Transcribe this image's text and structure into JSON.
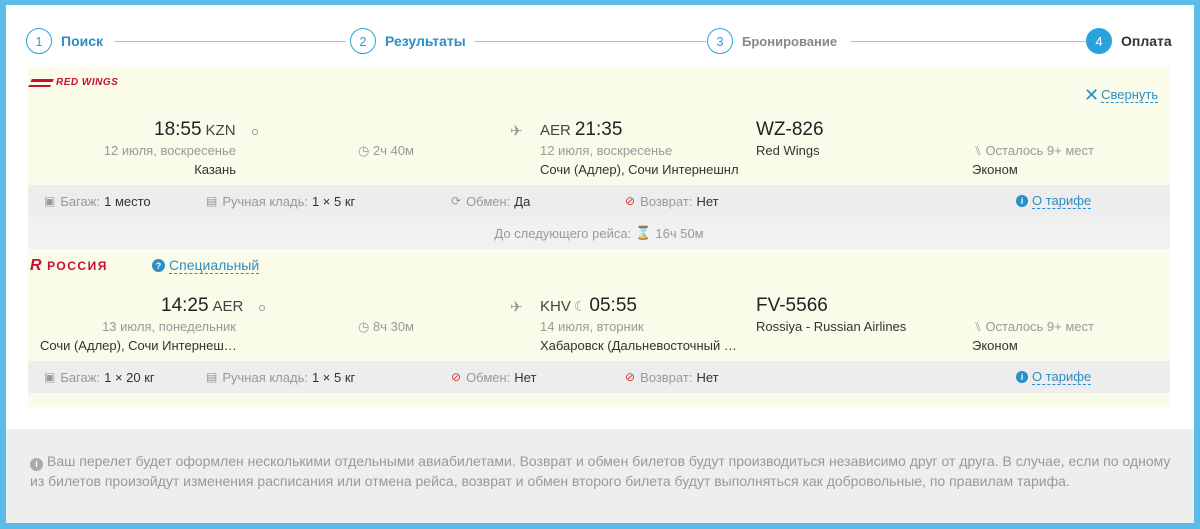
{
  "steps": [
    {
      "num": "1",
      "label": "Поиск"
    },
    {
      "num": "2",
      "label": "Результаты"
    },
    {
      "num": "3",
      "label": "Бронирование"
    },
    {
      "num": "4",
      "label": "Оплата"
    }
  ],
  "collapse_label": "Свернуть",
  "segments": [
    {
      "airline_logo": "RED WINGS",
      "dep_time": "18:55",
      "dep_code": "KZN",
      "dep_date": "12 июля, воскресенье",
      "dep_city": "Казань",
      "duration": "2ч 40м",
      "arr_code": "AER",
      "arr_time": "21:35",
      "arr_date": "12 июля, воскресенье",
      "arr_city": "Сочи (Адлер), Сочи Интернешнл",
      "flight_no": "WZ-826",
      "airline": "Red Wings",
      "seats": "Осталось 9+ мест",
      "class": "Эконом",
      "baggage_label": "Багаж:",
      "baggage_value": "1 место",
      "carryon_label": "Ручная кладь:",
      "carryon_value": "1 × 5 кг",
      "exchange_label": "Обмен:",
      "exchange_value": "Да",
      "refund_label": "Возврат:",
      "refund_value": "Нет",
      "tariff_link": "О тарифе"
    },
    {
      "airline_logo": "РОССИЯ",
      "fare_type": "Специальный",
      "dep_time": "14:25",
      "dep_code": "AER",
      "dep_date": "13 июля, понедельник",
      "dep_city": "Сочи (Адлер), Сочи Интернеш…",
      "duration": "8ч 30м",
      "arr_code": "KHV",
      "arr_time": "05:55",
      "arr_date": "14 июля, вторник",
      "arr_city": "Хабаровск (Дальневосточный …",
      "flight_no": "FV-5566",
      "airline": "Rossiya - Russian Airlines",
      "seats": "Осталось 9+ мест",
      "class": "Эконом",
      "baggage_label": "Багаж:",
      "baggage_value": "1 × 20 кг",
      "carryon_label": "Ручная кладь:",
      "carryon_value": "1 × 5 кг",
      "exchange_label": "Обмен:",
      "exchange_value": "Нет",
      "refund_label": "Возврат:",
      "refund_value": "Нет",
      "tariff_link": "О тарифе"
    }
  ],
  "layover": "До следующего рейса:",
  "layover_time": "16ч 50м",
  "notice": "Ваш перелет будет оформлен несколькими отдельными авиабилетами. Возврат и обмен билетов будут производиться независимо друг от друга. В случае, если по одному из билетов произойдут изменения расписания или отмена рейса, возврат и обмен второго билета будут выполняться как добровольные, по правилам тарифа."
}
